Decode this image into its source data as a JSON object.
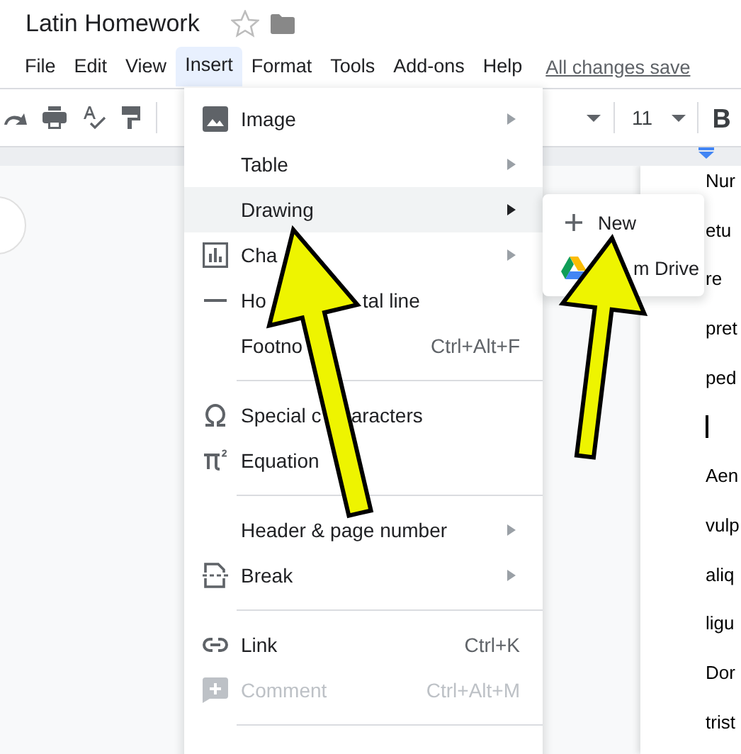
{
  "document": {
    "title": "Latin Homework",
    "starred": false
  },
  "menubar": [
    {
      "label": "File",
      "selected": false
    },
    {
      "label": "Edit",
      "selected": false
    },
    {
      "label": "View",
      "selected": false
    },
    {
      "label": "Insert",
      "selected": true
    },
    {
      "label": "Format",
      "selected": false
    },
    {
      "label": "Tools",
      "selected": false
    },
    {
      "label": "Add-ons",
      "selected": false
    },
    {
      "label": "Help",
      "selected": false
    }
  ],
  "save_status": "All changes save",
  "toolbar": {
    "font_size": "11"
  },
  "insert_menu": {
    "items": [
      {
        "kind": "item",
        "label": "Image",
        "has_submenu": true,
        "selected": false,
        "disabled": false
      },
      {
        "kind": "item",
        "label": "Table",
        "has_submenu": true,
        "selected": false,
        "disabled": false
      },
      {
        "kind": "item",
        "label": "Drawing",
        "has_submenu": true,
        "selected": true,
        "disabled": false
      },
      {
        "kind": "item",
        "label": "Cha",
        "has_submenu": true,
        "selected": false,
        "disabled": false
      },
      {
        "kind": "item",
        "label": "Ho",
        "label_after": "tal line",
        "has_submenu": false,
        "selected": false,
        "disabled": false
      },
      {
        "kind": "item",
        "label": "Footno",
        "shortcut": "Ctrl+Alt+F",
        "has_submenu": false,
        "selected": false,
        "disabled": false
      },
      {
        "kind": "divider"
      },
      {
        "kind": "item",
        "label": "Special c",
        "label_after": "aracters",
        "has_submenu": false,
        "selected": false,
        "disabled": false
      },
      {
        "kind": "item",
        "label": "Equation",
        "has_submenu": false,
        "selected": false,
        "disabled": false
      },
      {
        "kind": "divider"
      },
      {
        "kind": "item",
        "label": "Header & page number",
        "has_submenu": true,
        "selected": false,
        "disabled": false
      },
      {
        "kind": "item",
        "label": "Break",
        "has_submenu": true,
        "selected": false,
        "disabled": false
      },
      {
        "kind": "divider"
      },
      {
        "kind": "item",
        "label": "Link",
        "shortcut": "Ctrl+K",
        "has_submenu": false,
        "selected": false,
        "disabled": false
      },
      {
        "kind": "item",
        "label": "Comment",
        "shortcut": "Ctrl+Alt+M",
        "has_submenu": false,
        "selected": false,
        "disabled": true
      },
      {
        "kind": "divider"
      }
    ]
  },
  "drawing_submenu": {
    "items": [
      {
        "label": "New",
        "selected": false
      },
      {
        "label": "m Drive",
        "selected": false
      }
    ]
  },
  "page_lines": [
    {
      "kind": "text",
      "text": "Nur"
    },
    {
      "kind": "text",
      "text": "etu"
    },
    {
      "kind": "text",
      "text": "re"
    },
    {
      "kind": "text",
      "text": "pret"
    },
    {
      "kind": "text",
      "text": "ped"
    },
    {
      "kind": "cursor"
    },
    {
      "kind": "text",
      "text": "Aen"
    },
    {
      "kind": "text",
      "text": "vulp"
    },
    {
      "kind": "text",
      "text": "aliq"
    },
    {
      "kind": "text",
      "text": "ligu"
    },
    {
      "kind": "text",
      "text": "Dor"
    },
    {
      "kind": "text",
      "text": "trist"
    }
  ]
}
